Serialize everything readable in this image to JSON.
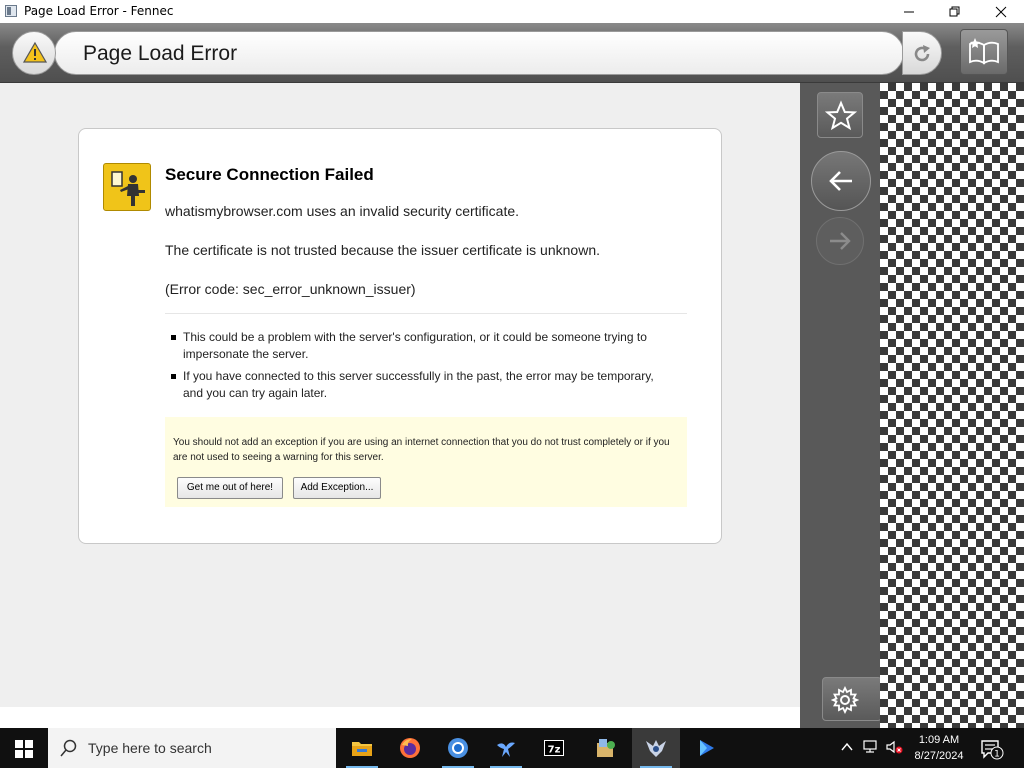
{
  "window": {
    "title": "Page Load Error - Fennec",
    "minimize_glyph": "minimize",
    "maximize_glyph": "restore",
    "close_glyph": "close"
  },
  "toolbar": {
    "url_text": "Page Load Error",
    "site_icon": "warning-triangle-icon",
    "reload_icon": "reload-icon",
    "reader_icon": "reader-mode-icon"
  },
  "error": {
    "title": "Secure Connection Failed",
    "lines": [
      "whatismybrowser.com uses an invalid security certificate.",
      "The certificate is not trusted because the issuer certificate is unknown.",
      "(Error code: sec_error_unknown_issuer)"
    ],
    "bullets": [
      "This could be a problem with the server's configuration, or it could be someone trying to impersonate the server.",
      "If you have connected to this server successfully in the past, the error may be temporary, and you can try again later."
    ],
    "warning_text": "You should not add an exception if you are using an internet connection that you do not trust completely or if you are not used to seeing a warning for this server.",
    "buttons": {
      "get_out": "Get me out of here!",
      "add_exception": "Add Exception..."
    }
  },
  "sidebar": {
    "star_icon": "bookmark-star-icon",
    "back_icon": "back-arrow-icon",
    "forward_icon": "forward-arrow-icon",
    "settings_icon": "settings-gear-icon"
  },
  "taskbar": {
    "search_placeholder": "Type here to search",
    "apps": [
      "file-explorer",
      "firefox",
      "chromium",
      "app-bird",
      "7zip",
      "app-installer",
      "fennec",
      "copilot"
    ],
    "clock_time": "1:09 AM",
    "clock_date": "8/27/2024",
    "notification_count": "1"
  },
  "colors": {
    "accent": "#76b9ed",
    "warning_panel": "#fffde1",
    "cert_icon": "#f0c419"
  }
}
